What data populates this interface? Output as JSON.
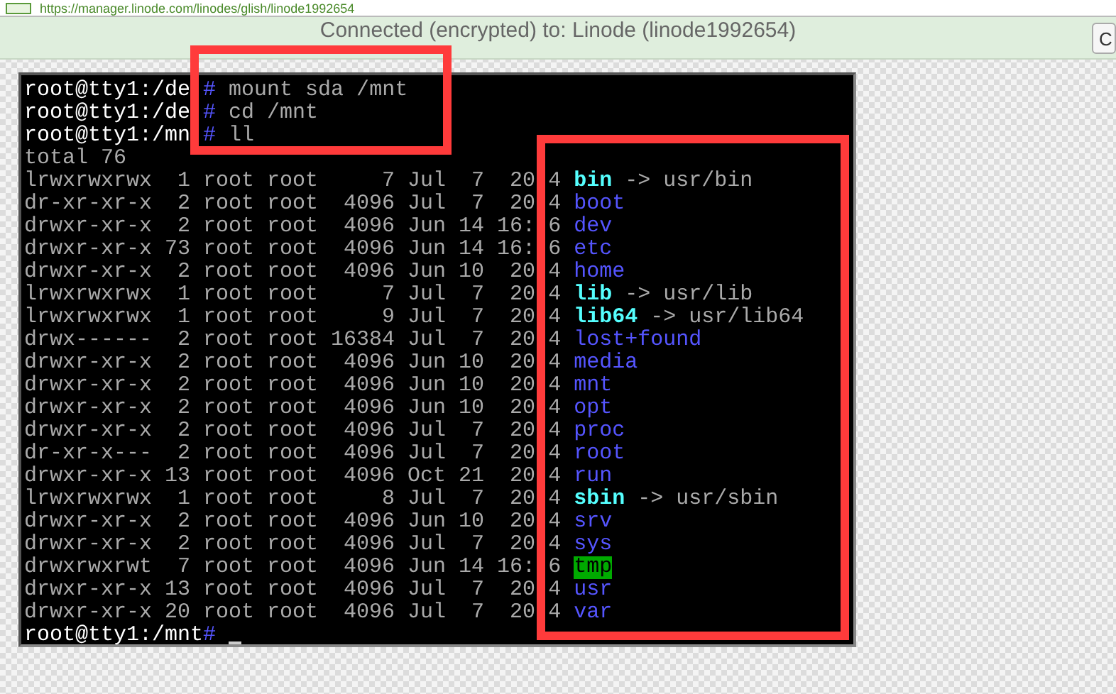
{
  "address_bar": {
    "url": "https://manager.linode.com/linodes/glish/linode1992654"
  },
  "banner": {
    "message": "Connected (encrypted) to: Linode (linode1992654)",
    "button": "C"
  },
  "terminal": {
    "commands": [
      {
        "prompt": "root@tty1:/de",
        "symbol": "#",
        "command": "mount sda /mnt"
      },
      {
        "prompt": "root@tty1:/de",
        "symbol": "#",
        "command": "cd /mnt"
      },
      {
        "prompt": "root@tty1:/mn",
        "symbol": "#",
        "command": "ll"
      }
    ],
    "total": "total 76",
    "files": [
      {
        "details": "lrwxrwxrwx  1 root root     7 Jul  7  20",
        "tail": "4",
        "name": "bin",
        "kind": "link",
        "arrow": "->",
        "target": "usr/bin"
      },
      {
        "details": "dr-xr-xr-x  2 root root  4096 Jul  7  20",
        "tail": "4",
        "name": "boot",
        "kind": "dir"
      },
      {
        "details": "drwxr-xr-x  2 root root  4096 Jun 14 16:",
        "tail": "6",
        "name": "dev",
        "kind": "dir"
      },
      {
        "details": "drwxr-xr-x 73 root root  4096 Jun 14 16:",
        "tail": "6",
        "name": "etc",
        "kind": "dir"
      },
      {
        "details": "drwxr-xr-x  2 root root  4096 Jun 10  20",
        "tail": "4",
        "name": "home",
        "kind": "dir"
      },
      {
        "details": "lrwxrwxrwx  1 root root     7 Jul  7  20",
        "tail": "4",
        "name": "lib",
        "kind": "link",
        "arrow": "->",
        "target": "usr/lib"
      },
      {
        "details": "lrwxrwxrwx  1 root root     9 Jul  7  20",
        "tail": "4",
        "name": "lib64",
        "kind": "link",
        "arrow": "->",
        "target": "usr/lib64"
      },
      {
        "details": "drwx------  2 root root 16384 Jul  7  20",
        "tail": "4",
        "name": "lost+found",
        "kind": "dir"
      },
      {
        "details": "drwxr-xr-x  2 root root  4096 Jun 10  20",
        "tail": "4",
        "name": "media",
        "kind": "dir"
      },
      {
        "details": "drwxr-xr-x  2 root root  4096 Jun 10  20",
        "tail": "4",
        "name": "mnt",
        "kind": "dir"
      },
      {
        "details": "drwxr-xr-x  2 root root  4096 Jun 10  20",
        "tail": "4",
        "name": "opt",
        "kind": "dir"
      },
      {
        "details": "drwxr-xr-x  2 root root  4096 Jul  7  20",
        "tail": "4",
        "name": "proc",
        "kind": "dir"
      },
      {
        "details": "dr-xr-x---  2 root root  4096 Jul  7  20",
        "tail": "4",
        "name": "root",
        "kind": "dir"
      },
      {
        "details": "drwxr-xr-x 13 root root  4096 Oct 21  20",
        "tail": "4",
        "name": "run",
        "kind": "dir"
      },
      {
        "details": "lrwxrwxrwx  1 root root     8 Jul  7  20",
        "tail": "4",
        "name": "sbin",
        "kind": "link",
        "arrow": "->",
        "target": "usr/sbin"
      },
      {
        "details": "drwxr-xr-x  2 root root  4096 Jun 10  20",
        "tail": "4",
        "name": "srv",
        "kind": "dir"
      },
      {
        "details": "drwxr-xr-x  2 root root  4096 Jul  7  20",
        "tail": "4",
        "name": "sys",
        "kind": "dir"
      },
      {
        "details": "drwxrwxrwt  7 root root  4096 Jun 14 16:",
        "tail": "6",
        "name": "tmp",
        "kind": "sticky"
      },
      {
        "details": "drwxr-xr-x 13 root root  4096 Jul  7  20",
        "tail": "4",
        "name": "usr",
        "kind": "dir"
      },
      {
        "details": "drwxr-xr-x 20 root root  4096 Jul  7  20",
        "tail": "4",
        "name": "var",
        "kind": "dir"
      }
    ],
    "final_prompt": {
      "prompt": "root@tty1:/mnt",
      "symbol": "#",
      "cursor": true
    }
  }
}
